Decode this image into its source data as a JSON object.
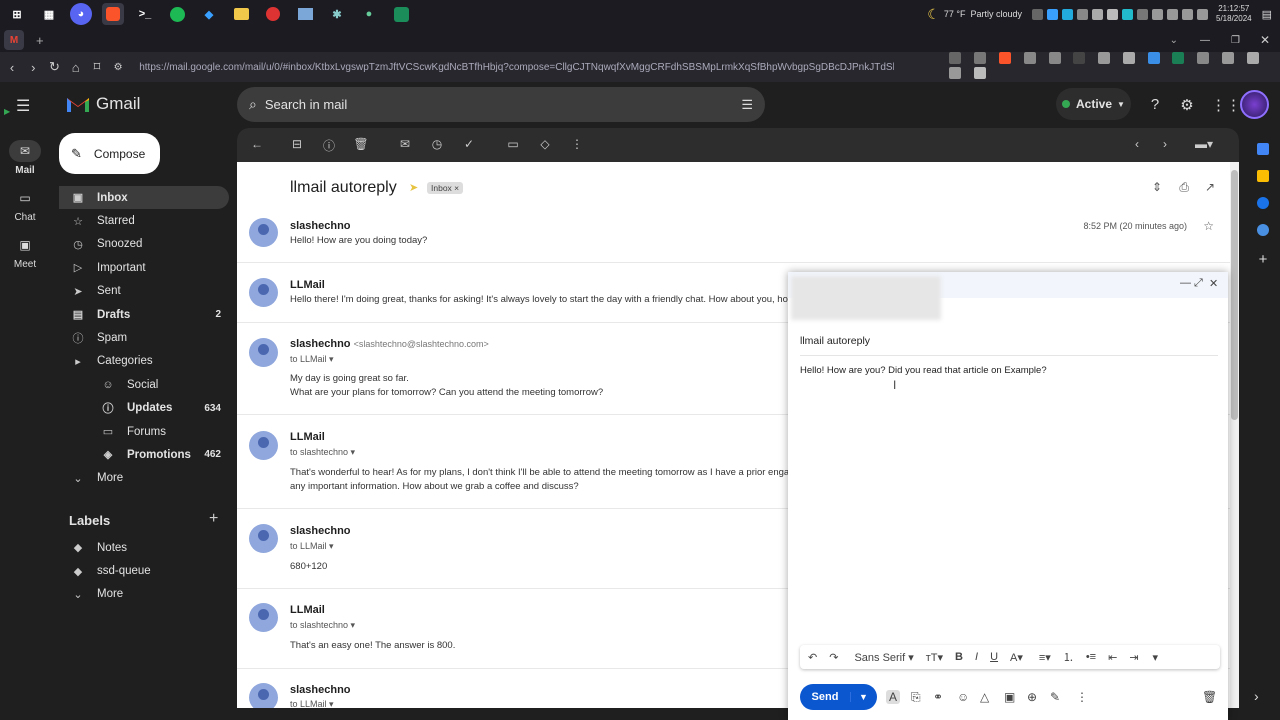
{
  "taskbar": {
    "weather_temp": "77 °F",
    "weather_desc": "Partly cloudy",
    "time": "21:12:57",
    "date": "5/18/2024"
  },
  "browser": {
    "url": "https://mail.google.com/mail/u/0/#inbox/KtbxLvgswpTzmJftVCScwKgdNcBTfhHbjq?compose=CllgCJTNqwqfXvMggCRFdhSBSMpLrmkXqSfBhpWvbgpSgDBcDJPnkJTdSkDcPtQsbbrlzBdlmwL"
  },
  "rail": {
    "mail": "Mail",
    "chat": "Chat",
    "meet": "Meet"
  },
  "brand": {
    "name": "Gmail"
  },
  "search": {
    "placeholder": "Search in mail"
  },
  "status": {
    "label": "Active"
  },
  "compose_button": {
    "label": "Compose"
  },
  "nav": {
    "inbox": "Inbox",
    "starred": "Starred",
    "snoozed": "Snoozed",
    "important": "Important",
    "sent": "Sent",
    "drafts": "Drafts",
    "drafts_count": "2",
    "spam": "Spam",
    "categories": "Categories",
    "social": "Social",
    "updates": "Updates",
    "updates_count": "634",
    "forums": "Forums",
    "promotions": "Promotions",
    "promotions_count": "462",
    "more": "More"
  },
  "labels": {
    "heading": "Labels",
    "notes": "Notes",
    "ssd": "ssd-queue",
    "more": "More"
  },
  "thread": {
    "subject": "llmail autoreply",
    "chip": "Inbox",
    "messages": [
      {
        "sender": "slashechno",
        "time": "8:52 PM (20 minutes ago)",
        "snippet": "Hello! How are you doing today?"
      },
      {
        "sender": "LLMail",
        "snippet": "Hello there! I'm doing great, thanks for asking! It's always lovely to start the day with a friendly chat. How about you, ho"
      },
      {
        "sender": "slashechno",
        "email": "<slashtechno@slashtechno.com>",
        "to": "to LLMail",
        "line1": "My day is going great so far.",
        "line2": "What are your plans for tomorrow? Can you attend the meeting tomorrow?"
      },
      {
        "sender": "LLMail",
        "to": "to slashtechno",
        "line1": "That's wonderful to hear! As for my plans, I don't think I'll be able to attend the meeting tomorrow as I have a prior enga",
        "line2": "any important information. How about we grab a coffee and discuss?"
      },
      {
        "sender": "slashechno",
        "to": "to LLMail",
        "snippet": "680+120"
      },
      {
        "sender": "LLMail",
        "to": "to slashtechno",
        "snippet": "That's an easy one! The answer is 800."
      },
      {
        "sender": "slashechno",
        "to": "to LLMail"
      }
    ]
  },
  "compose_window": {
    "subject": "llmail autoreply",
    "body": "Hello! How are you? Did you read that article on Example?",
    "font": "Sans Serif",
    "send_label": "Send"
  }
}
